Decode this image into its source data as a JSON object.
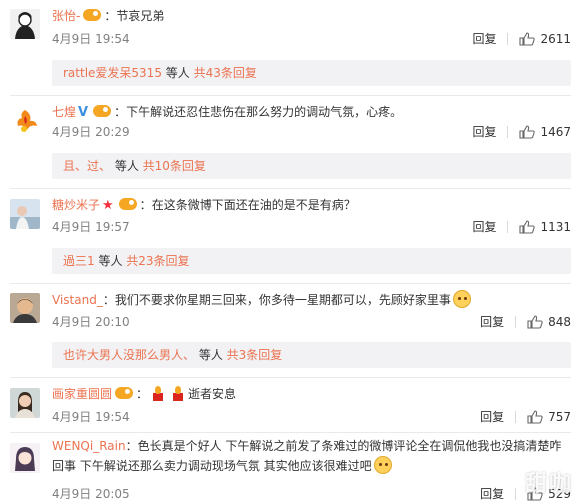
{
  "comments": [
    {
      "username": "张怡-",
      "colon": "：",
      "text": "节哀兄弟",
      "time": "4月9日 19:54",
      "reply_label": "回复",
      "likes": "2611",
      "sub": {
        "user": "rattle爱发呆5315",
        "mid": " 等人 ",
        "more": "共43条回复"
      },
      "avatar_icon": "sketch-portrait-avatar"
    },
    {
      "username": "七煌",
      "colon": "：",
      "text": "下午解说还忍住悲伤在那么努力的调动气氛，心疼。",
      "time": "4月9日 20:29",
      "reply_label": "回复",
      "likes": "1467",
      "sub": {
        "user": "且、过、",
        "mid": " 等人 ",
        "more": "共10条回复"
      },
      "avatar_icon": "phoenix-logo-avatar"
    },
    {
      "username": "糖炒米子",
      "colon": "：",
      "text": "在这条微博下面还在油的是不是有病？",
      "time": "4月9日 19:57",
      "reply_label": "回复",
      "likes": "1131",
      "sub": {
        "user": "過三1",
        "mid": " 等人 ",
        "more": "共23条回复"
      },
      "avatar_icon": "photo-avatar"
    },
    {
      "username": "Vistand_",
      "colon": "：",
      "text": "我们不要求你星期三回来，你多待一星期都可以，先顾好家里事",
      "time": "4月9日 20:10",
      "reply_label": "回复",
      "likes": "848",
      "sub": {
        "user": "也许大男人没那么男人、",
        "mid": " 等人 ",
        "more": "共3条回复"
      },
      "avatar_icon": "selfie-avatar"
    },
    {
      "username": "画家重圆圆",
      "colon": "：",
      "text": "逝者安息",
      "time": "4月9日 19:54",
      "reply_label": "回复",
      "likes": "757",
      "avatar_icon": "portrait-avatar"
    },
    {
      "username": "WENQi_Rain",
      "colon": "：",
      "text": "色长真是个好人 下午解说之前发了条难过的微博评论全在调侃他我也没搞清楚咋回事 下午解说还那么卖力调动现场气氛 其实他应该很难过吧",
      "time": "4月9日 20:05",
      "reply_label": "回复",
      "likes": "529",
      "avatar_icon": "anime-girl-avatar"
    }
  ],
  "watermark": "甜咖"
}
